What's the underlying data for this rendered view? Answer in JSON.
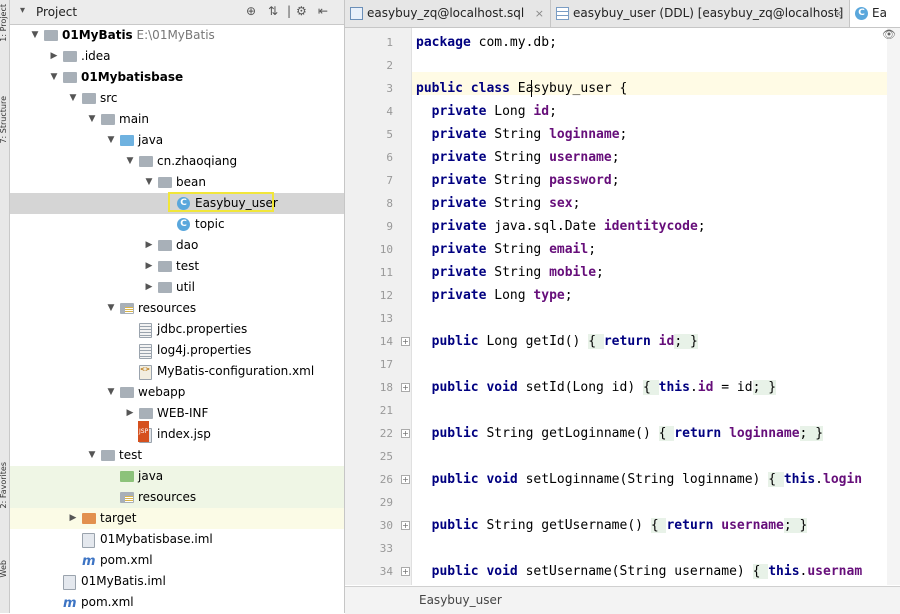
{
  "left_strip": {
    "project_label": "1: Project",
    "structure_label": "7: Structure",
    "favorites_label": "2: Favorites",
    "web_label": "Web"
  },
  "project_panel": {
    "title": "Project",
    "tree": [
      {
        "label": "01MyBatis",
        "path": "E:\\01MyBatis",
        "bold": true,
        "indent": 0,
        "arrow": "down",
        "icon": "folder"
      },
      {
        "label": ".idea",
        "indent": 1,
        "arrow": "right",
        "icon": "folder"
      },
      {
        "label": "01Mybatisbase",
        "bold": true,
        "indent": 1,
        "arrow": "down",
        "icon": "folder"
      },
      {
        "label": "src",
        "indent": 2,
        "arrow": "down",
        "icon": "folder"
      },
      {
        "label": "main",
        "indent": 3,
        "arrow": "down",
        "icon": "folder"
      },
      {
        "label": "java",
        "indent": 4,
        "arrow": "down",
        "icon": "folder-blue"
      },
      {
        "label": "cn.zhaoqiang",
        "indent": 5,
        "arrow": "down",
        "icon": "folder"
      },
      {
        "label": "bean",
        "indent": 6,
        "arrow": "down",
        "icon": "folder"
      },
      {
        "label": "Easybuy_user",
        "indent": 7,
        "arrow": "",
        "icon": "class",
        "selected": true
      },
      {
        "label": "topic",
        "indent": 7,
        "arrow": "",
        "icon": "class"
      },
      {
        "label": "dao",
        "indent": 6,
        "arrow": "right",
        "icon": "folder"
      },
      {
        "label": "test",
        "indent": 6,
        "arrow": "right",
        "icon": "folder"
      },
      {
        "label": "util",
        "indent": 6,
        "arrow": "right",
        "icon": "folder"
      },
      {
        "label": "resources",
        "indent": 4,
        "arrow": "down",
        "icon": "folder-res"
      },
      {
        "label": "jdbc.properties",
        "indent": 5,
        "arrow": "",
        "icon": "file-prop"
      },
      {
        "label": "log4j.properties",
        "indent": 5,
        "arrow": "",
        "icon": "file-prop"
      },
      {
        "label": "MyBatis-configuration.xml",
        "indent": 5,
        "arrow": "",
        "icon": "file-xml"
      },
      {
        "label": "webapp",
        "indent": 4,
        "arrow": "down",
        "icon": "folder"
      },
      {
        "label": "WEB-INF",
        "indent": 5,
        "arrow": "right",
        "icon": "folder"
      },
      {
        "label": "index.jsp",
        "indent": 5,
        "arrow": "",
        "icon": "file-jsp"
      },
      {
        "label": "test",
        "indent": 3,
        "arrow": "down",
        "icon": "folder"
      },
      {
        "label": "java",
        "indent": 4,
        "arrow": "",
        "icon": "folder-green",
        "green": true
      },
      {
        "label": "resources",
        "indent": 4,
        "arrow": "",
        "icon": "folder-res",
        "green": true
      },
      {
        "label": "target",
        "indent": 2,
        "arrow": "right",
        "icon": "folder-orange",
        "target": true
      },
      {
        "label": "01Mybatisbase.iml",
        "indent": 2,
        "arrow": "",
        "icon": "file-iml"
      },
      {
        "label": "pom.xml",
        "indent": 2,
        "arrow": "",
        "icon": "maven"
      },
      {
        "label": "01MyBatis.iml",
        "indent": 1,
        "arrow": "",
        "icon": "file-iml"
      },
      {
        "label": "pom.xml",
        "indent": 1,
        "arrow": "",
        "icon": "maven"
      }
    ]
  },
  "tabs": [
    {
      "label": "easybuy_zq@localhost.sql",
      "icon": "sql",
      "close": "×"
    },
    {
      "label": "easybuy_user (DDL) [easybuy_zq@localhost]",
      "icon": "table",
      "close": "×"
    },
    {
      "label": "Ea",
      "icon": "class",
      "active": true
    }
  ],
  "breadcrumb": "Easybuy_user",
  "code_lines": [
    {
      "n": "1",
      "fold": false,
      "t": [
        [
          "kw",
          "package"
        ],
        [
          "p",
          " com.my.db;"
        ]
      ]
    },
    {
      "n": "2",
      "fold": false,
      "t": []
    },
    {
      "n": "3",
      "fold": false,
      "caret": true,
      "t": [
        [
          "kw",
          "public class"
        ],
        [
          "p",
          " Easybuy_user {"
        ]
      ]
    },
    {
      "n": "4",
      "fold": false,
      "t": [
        [
          "p",
          "  "
        ],
        [
          "kw",
          "private"
        ],
        [
          "p",
          " Long "
        ],
        [
          "fld",
          "id"
        ],
        [
          "p",
          ";"
        ]
      ]
    },
    {
      "n": "5",
      "fold": false,
      "t": [
        [
          "p",
          "  "
        ],
        [
          "kw",
          "private"
        ],
        [
          "p",
          " String "
        ],
        [
          "fld",
          "loginname"
        ],
        [
          "p",
          ";"
        ]
      ]
    },
    {
      "n": "6",
      "fold": false,
      "t": [
        [
          "p",
          "  "
        ],
        [
          "kw",
          "private"
        ],
        [
          "p",
          " String "
        ],
        [
          "fld",
          "username"
        ],
        [
          "p",
          ";"
        ]
      ]
    },
    {
      "n": "7",
      "fold": false,
      "t": [
        [
          "p",
          "  "
        ],
        [
          "kw",
          "private"
        ],
        [
          "p",
          " String "
        ],
        [
          "fld",
          "password"
        ],
        [
          "p",
          ";"
        ]
      ]
    },
    {
      "n": "8",
      "fold": false,
      "t": [
        [
          "p",
          "  "
        ],
        [
          "kw",
          "private"
        ],
        [
          "p",
          " String "
        ],
        [
          "fld",
          "sex"
        ],
        [
          "p",
          ";"
        ]
      ]
    },
    {
      "n": "9",
      "fold": false,
      "t": [
        [
          "p",
          "  "
        ],
        [
          "kw",
          "private"
        ],
        [
          "p",
          " java.sql.Date "
        ],
        [
          "fld",
          "identitycode"
        ],
        [
          "p",
          ";"
        ]
      ]
    },
    {
      "n": "10",
      "fold": false,
      "t": [
        [
          "p",
          "  "
        ],
        [
          "kw",
          "private"
        ],
        [
          "p",
          " String "
        ],
        [
          "fld",
          "email"
        ],
        [
          "p",
          ";"
        ]
      ]
    },
    {
      "n": "11",
      "fold": false,
      "t": [
        [
          "p",
          "  "
        ],
        [
          "kw",
          "private"
        ],
        [
          "p",
          " String "
        ],
        [
          "fld",
          "mobile"
        ],
        [
          "p",
          ";"
        ]
      ]
    },
    {
      "n": "12",
      "fold": false,
      "t": [
        [
          "p",
          "  "
        ],
        [
          "kw",
          "private"
        ],
        [
          "p",
          " Long "
        ],
        [
          "fld",
          "type"
        ],
        [
          "p",
          ";"
        ]
      ]
    },
    {
      "n": "13",
      "fold": false,
      "t": []
    },
    {
      "n": "14",
      "fold": true,
      "t": [
        [
          "p",
          "  "
        ],
        [
          "kw",
          "public"
        ],
        [
          "p",
          " Long getId() "
        ],
        [
          "bg",
          "{ "
        ],
        [
          "kw",
          "return"
        ],
        [
          "p",
          " "
        ],
        [
          "fld",
          "id"
        ],
        [
          "bg",
          "; }"
        ]
      ]
    },
    {
      "n": "17",
      "fold": false,
      "t": []
    },
    {
      "n": "18",
      "fold": true,
      "t": [
        [
          "p",
          "  "
        ],
        [
          "kw",
          "public void"
        ],
        [
          "p",
          " setId(Long id) "
        ],
        [
          "bg",
          "{ "
        ],
        [
          "kw",
          "this"
        ],
        [
          "p",
          "."
        ],
        [
          "fld",
          "id"
        ],
        [
          "p",
          " = id"
        ],
        [
          "bg",
          "; }"
        ]
      ]
    },
    {
      "n": "21",
      "fold": false,
      "t": []
    },
    {
      "n": "22",
      "fold": true,
      "t": [
        [
          "p",
          "  "
        ],
        [
          "kw",
          "public"
        ],
        [
          "p",
          " String getLoginname() "
        ],
        [
          "bg",
          "{ "
        ],
        [
          "kw",
          "return"
        ],
        [
          "p",
          " "
        ],
        [
          "fld",
          "loginname"
        ],
        [
          "bg",
          "; }"
        ]
      ]
    },
    {
      "n": "25",
      "fold": false,
      "t": []
    },
    {
      "n": "26",
      "fold": true,
      "t": [
        [
          "p",
          "  "
        ],
        [
          "kw",
          "public void"
        ],
        [
          "p",
          " setLoginname(String loginname) "
        ],
        [
          "bg",
          "{ "
        ],
        [
          "kw",
          "this"
        ],
        [
          "p",
          "."
        ],
        [
          "fld",
          "login"
        ]
      ]
    },
    {
      "n": "29",
      "fold": false,
      "t": []
    },
    {
      "n": "30",
      "fold": true,
      "t": [
        [
          "p",
          "  "
        ],
        [
          "kw",
          "public"
        ],
        [
          "p",
          " String getUsername() "
        ],
        [
          "bg",
          "{ "
        ],
        [
          "kw",
          "return"
        ],
        [
          "p",
          " "
        ],
        [
          "fld",
          "username"
        ],
        [
          "bg",
          "; }"
        ]
      ]
    },
    {
      "n": "33",
      "fold": false,
      "t": []
    },
    {
      "n": "34",
      "fold": true,
      "t": [
        [
          "p",
          "  "
        ],
        [
          "kw",
          "public void"
        ],
        [
          "p",
          " setUsername(String username) "
        ],
        [
          "bg",
          "{ "
        ],
        [
          "kw",
          "this"
        ],
        [
          "p",
          "."
        ],
        [
          "fld",
          "usernam"
        ]
      ]
    }
  ]
}
